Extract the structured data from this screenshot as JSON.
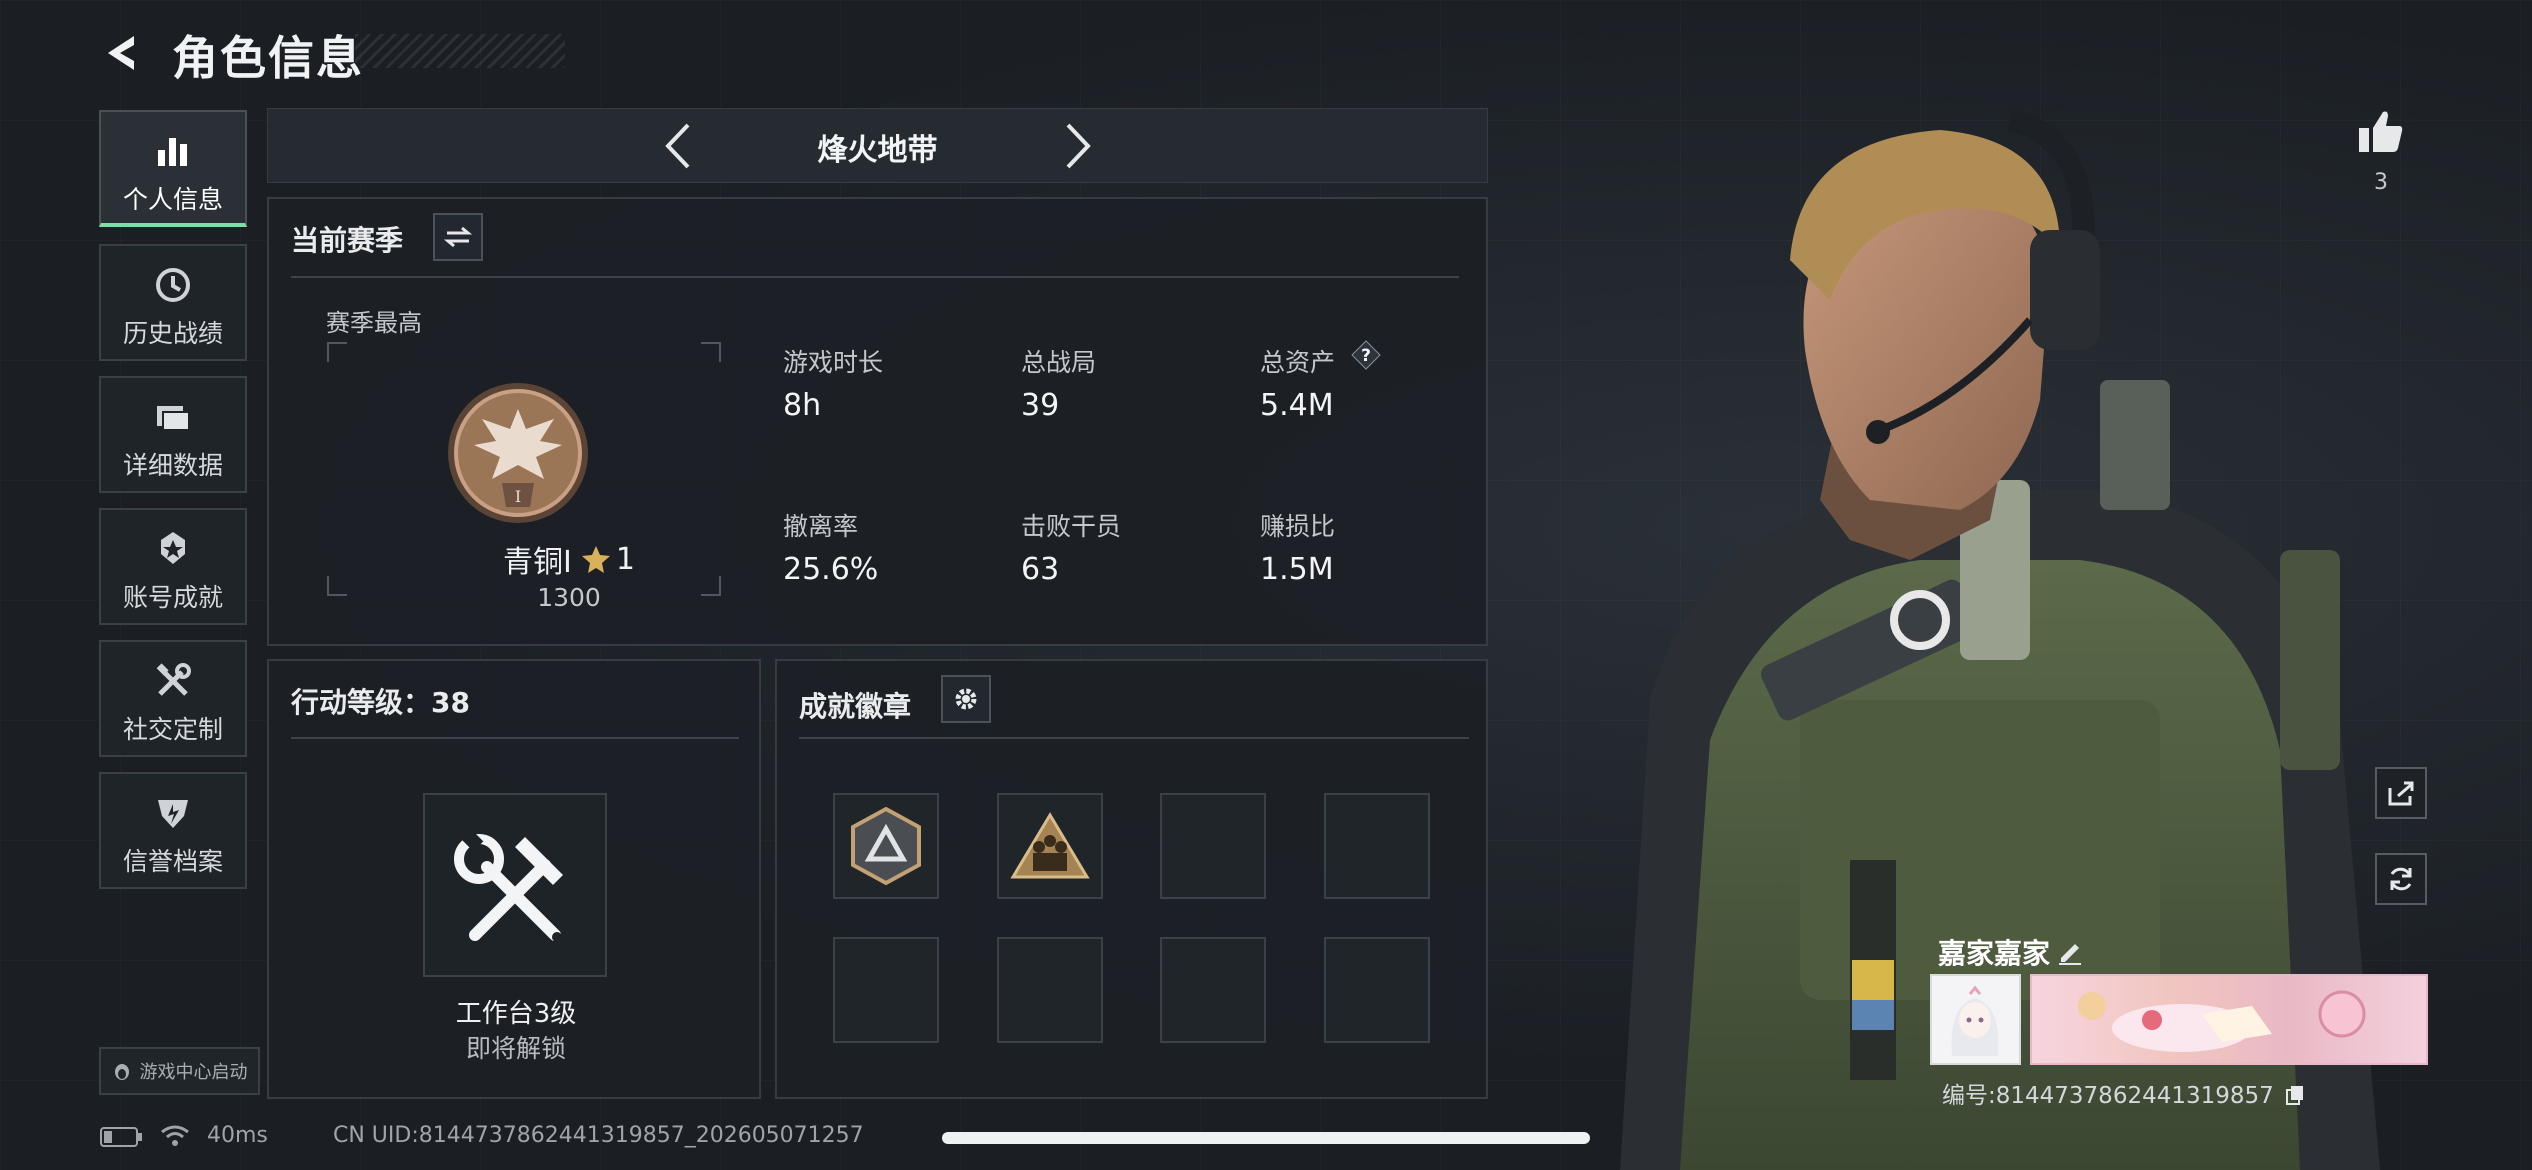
{
  "header": {
    "title": "角色信息"
  },
  "sidebar": {
    "items": [
      {
        "label": "个人信息",
        "icon": "bar-chart-icon",
        "active": true
      },
      {
        "label": "历史战绩",
        "icon": "clock-icon"
      },
      {
        "label": "详细数据",
        "icon": "folder-icon"
      },
      {
        "label": "账号成就",
        "icon": "medal-icon"
      },
      {
        "label": "社交定制",
        "icon": "tools-icon"
      },
      {
        "label": "信誉档案",
        "icon": "shield-icon"
      }
    ],
    "launch_label": "游戏中心启动"
  },
  "mode": {
    "name": "烽火地带"
  },
  "season": {
    "title": "当前赛季",
    "best_label": "赛季最高",
    "rank_name": "青铜I",
    "rank_stars": "1",
    "rank_score": "1300",
    "stats": [
      {
        "label": "游戏时长",
        "value": "8h"
      },
      {
        "label": "总战局",
        "value": "39"
      },
      {
        "label": "总资产",
        "value": "5.4M",
        "help": true
      },
      {
        "label": "撤离率",
        "value": "25.6%"
      },
      {
        "label": "击败干员",
        "value": "63"
      },
      {
        "label": "赚损比",
        "value": "1.5M"
      }
    ]
  },
  "action_level": {
    "title": "行动等级：38",
    "workbench_label": "工作台3级",
    "workbench_status": "即将解锁"
  },
  "achievements": {
    "title": "成就徽章"
  },
  "profile": {
    "like_count": "3",
    "player_name": "嘉家嘉家",
    "uid_line": "编号:8144737862441319857"
  },
  "status": {
    "ping": "40ms",
    "uid": "CN UID:8144737862441319857_202605071257"
  },
  "colors": {
    "accent_green": "#7be0a8",
    "bronze": "#9a7556"
  }
}
